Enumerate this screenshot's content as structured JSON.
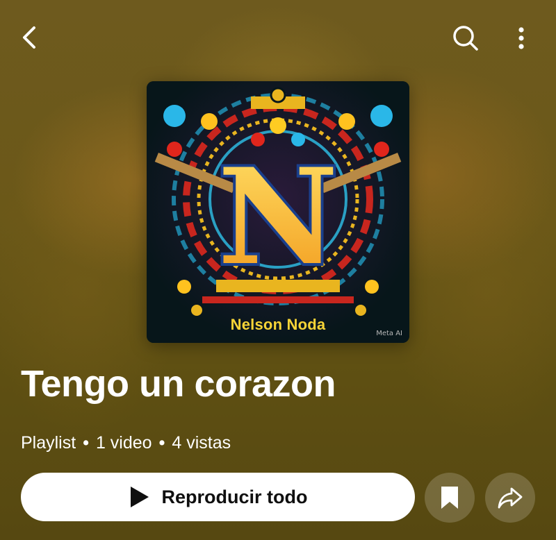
{
  "header": {
    "back_icon": "arrow-left-icon",
    "search_icon": "search-icon",
    "more_icon": "more-vertical-icon"
  },
  "artwork": {
    "letter": "N",
    "caption": "Nelson Noda",
    "watermark": "Meta AI"
  },
  "playlist": {
    "title": "Tengo un corazon",
    "type": "Playlist",
    "separator": "•",
    "video_count": "1 video",
    "views": "4 vistas"
  },
  "actions": {
    "play_all_label": "Reproducir todo",
    "play_icon": "play-icon",
    "save_icon": "bookmark-icon",
    "share_icon": "share-icon"
  },
  "colors": {
    "background": "#5e4f12",
    "text": "#ffffff",
    "button_bg": "#ffffff",
    "button_text": "#0f0f0f",
    "art_gold": "#f7d437"
  }
}
